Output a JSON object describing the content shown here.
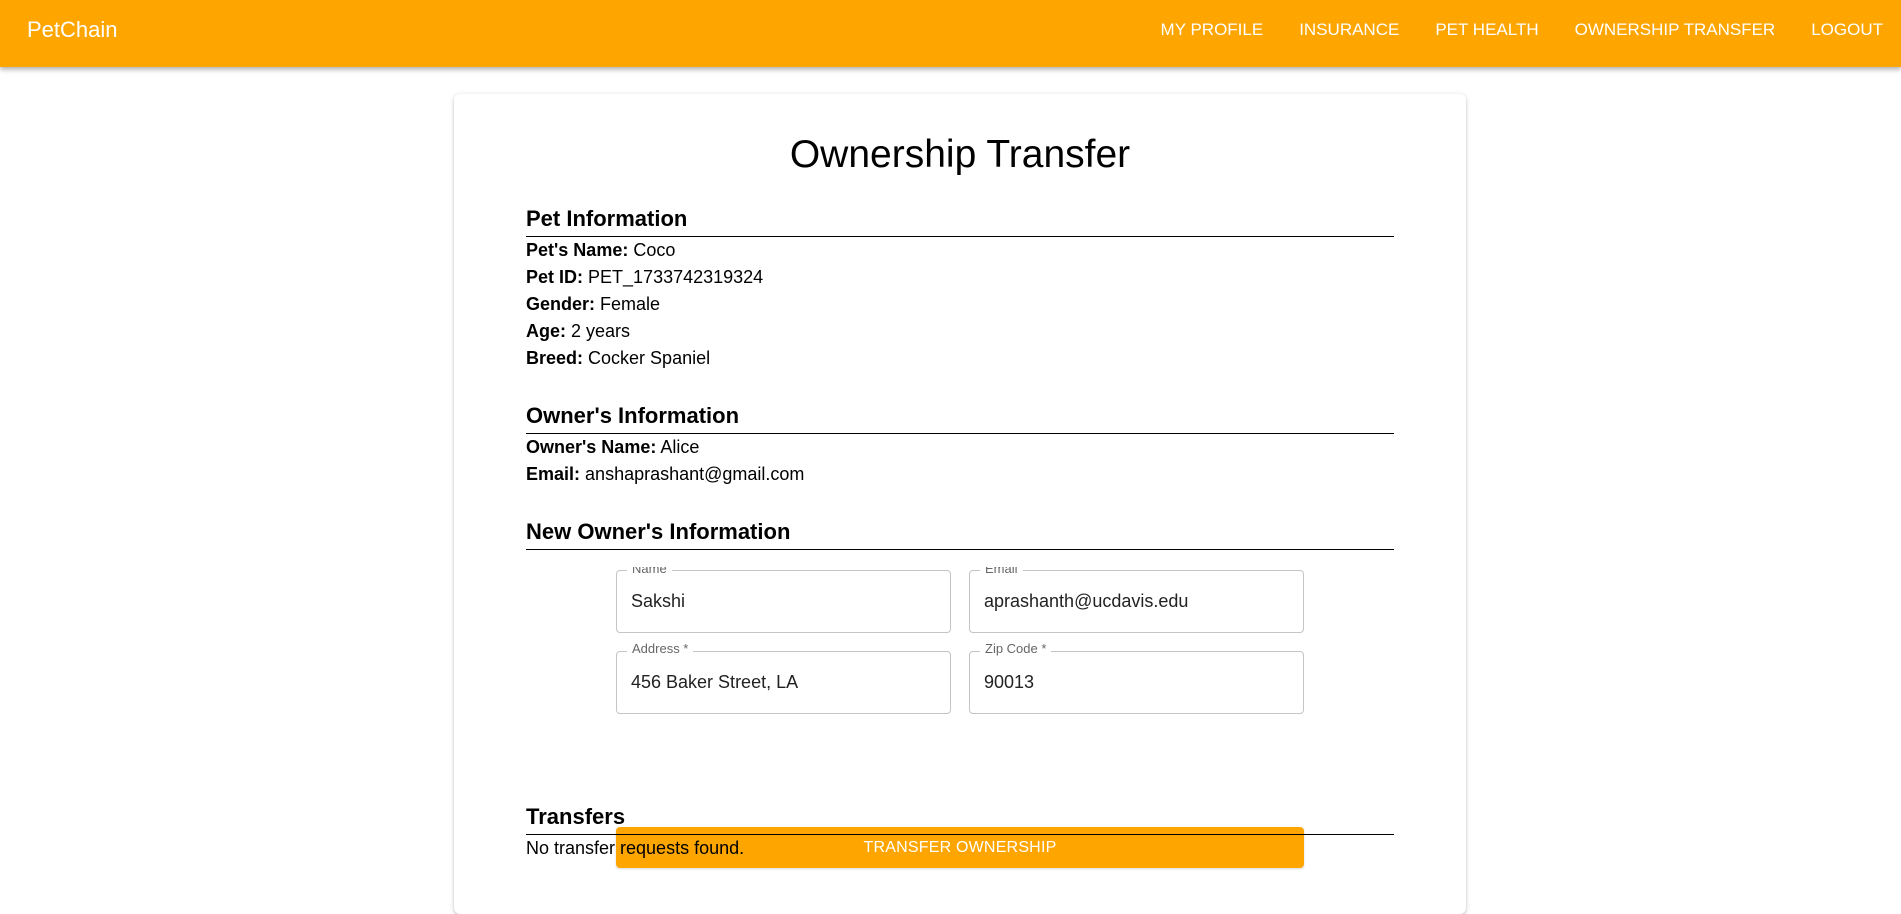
{
  "app": {
    "brand": "PetChain"
  },
  "nav": {
    "items": [
      "MY PROFILE",
      "INSURANCE",
      "PET HEALTH",
      "OWNERSHIP TRANSFER",
      "LOGOUT"
    ]
  },
  "page": {
    "title": "Ownership Transfer"
  },
  "pet_info": {
    "heading": "Pet Information",
    "name_label": "Pet's Name:",
    "name": "Coco",
    "id_label": "Pet ID:",
    "id": "PET_1733742319324",
    "gender_label": "Gender:",
    "gender": "Female",
    "age_label": "Age:",
    "age": "2 years",
    "breed_label": "Breed:",
    "breed": "Cocker Spaniel"
  },
  "owner_info": {
    "heading": "Owner's Information",
    "name_label": "Owner's Name:",
    "name": "Alice",
    "email_label": "Email:",
    "email": "anshaprashant@gmail.com"
  },
  "new_owner": {
    "heading": "New Owner's Information",
    "name_label": "Name",
    "name_value": "Sakshi",
    "email_label": "Email",
    "email_value": "aprashanth@ucdavis.edu",
    "address_label": "Address *",
    "address_value": "456 Baker Street, LA",
    "zip_label": "Zip Code *",
    "zip_value": "90013",
    "submit_label": "TRANSFER OWNERSHIP"
  },
  "transfers": {
    "heading": "Transfers",
    "empty_message": "No transfer requests found."
  },
  "colors": {
    "accent": "#FFA500",
    "nav_text": "#FFFFFF",
    "field_border": "#C4C4C4"
  }
}
